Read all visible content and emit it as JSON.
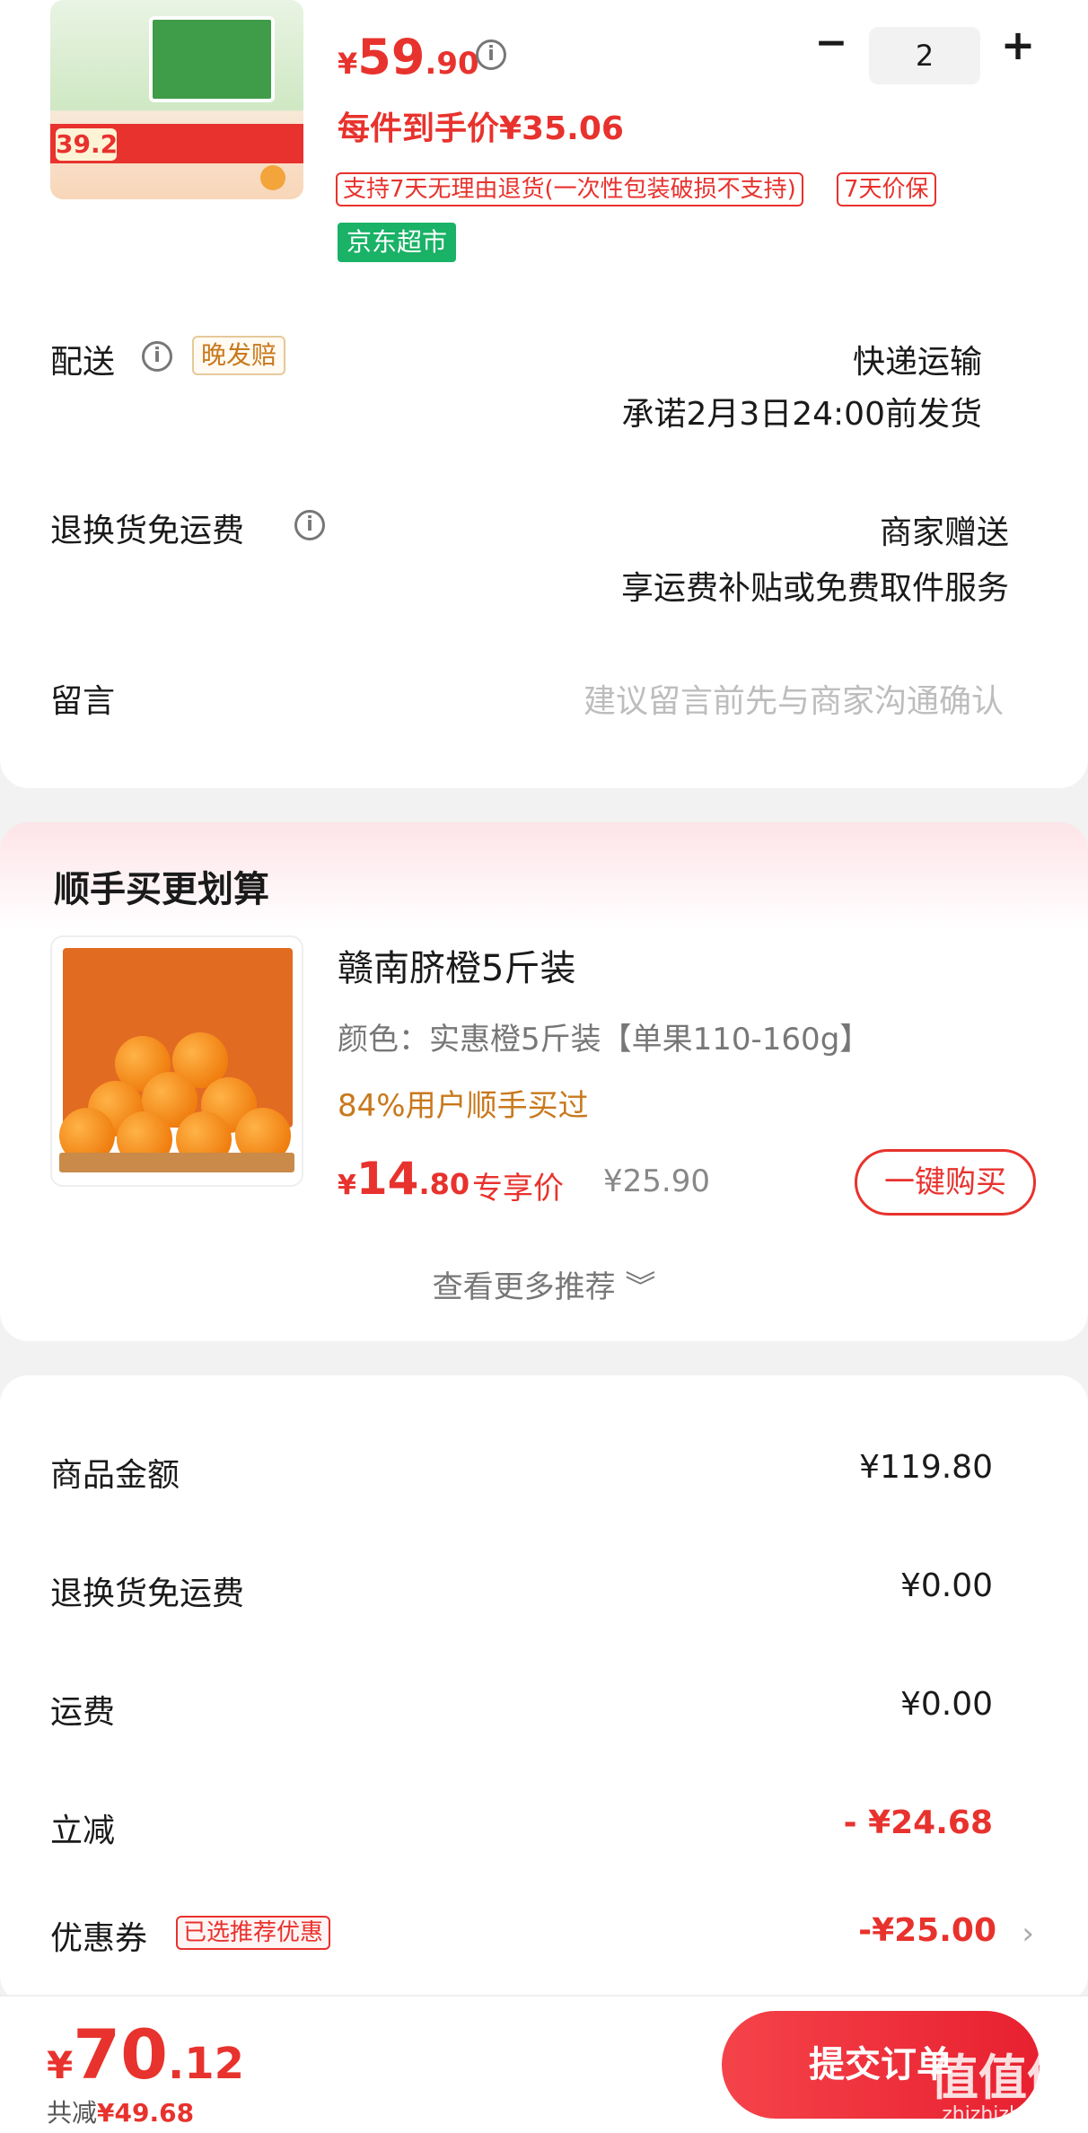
{
  "product": {
    "thumb_price": "39.2",
    "price_yen": "¥",
    "price_int": "59",
    "price_dec": ".90",
    "quantity": "2",
    "minus": "−",
    "plus": "+",
    "deal_price": "每件到手价¥35.06",
    "return_tag": "支持7天无理由退货(一次性包装破损不支持)",
    "price_protect_tag": "7天价保",
    "store_tag": "京东超市"
  },
  "delivery": {
    "label": "配送",
    "compensation_tag": "晚发赔",
    "method": "快递运输",
    "promise": "承诺2月3日24:00前发货"
  },
  "return_shipping": {
    "label": "退换货免运费",
    "provider": "商家赠送",
    "desc": "享运费补贴或免费取件服务"
  },
  "message": {
    "label": "留言",
    "placeholder": "建议留言前先与商家沟通确认"
  },
  "recommend": {
    "section_title": "顺手买更划算",
    "title": "赣南脐橙5斤装",
    "spec": "颜色：实惠橙5斤装【单果110-160g】",
    "social": "84%用户顺手买过",
    "price_yen": "¥",
    "price_int": "14",
    "price_dec": ".80",
    "exclusive_label": "专享价",
    "original_price": "¥25.90",
    "buy_button": "一键购买",
    "more_link": "查看更多推荐 ︾"
  },
  "summary": {
    "goods_amount_label": "商品金额",
    "goods_amount": "¥119.80",
    "return_shipping_label": "退换货免运费",
    "return_shipping_value": "¥0.00",
    "shipping_label": "运费",
    "shipping_value": "¥0.00",
    "instant_discount_label": "立减",
    "instant_discount_value": "- ¥24.68",
    "coupon_label": "优惠券",
    "coupon_tag": "已选推荐优惠",
    "coupon_value": "-¥25.00",
    "coupon_chevron": "›"
  },
  "checkout": {
    "total_yen": "¥",
    "total_int": "70",
    "total_dec": ".12",
    "saved_label": "共减",
    "saved_value": "¥49.68",
    "submit_button": "提交订单"
  },
  "watermark": {
    "logo": "值值值",
    "site": "zhizhizhi.com"
  },
  "colors": {
    "accent_red": "#e8322d",
    "store_green": "#19b266",
    "gold": "#c9781c"
  }
}
